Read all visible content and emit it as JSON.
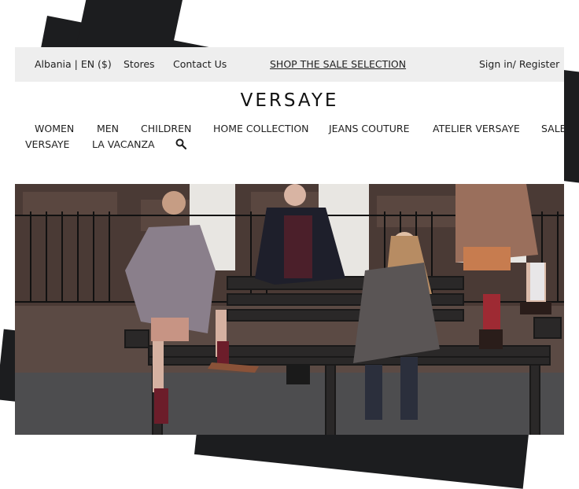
{
  "topbar": {
    "locale": "Albania | EN ($)",
    "stores": "Stores",
    "contact": "Contact Us",
    "sale_link": "SHOP THE SALE SELECTION",
    "signin": "Sign in/ Register"
  },
  "logo": "VERSAYE",
  "nav": {
    "items": [
      "WOMEN",
      "MEN",
      "CHILDREN",
      "HOME COLLECTION",
      "JEANS COUTURE",
      "ATELIER VERSAYE",
      "SALE",
      "VERSAYE",
      "LA VACANZA"
    ]
  },
  "icons": {
    "search": "search-icon"
  },
  "colors": {
    "topbar_bg": "#eeeeee",
    "tilt_cards": "#1c1d1f"
  }
}
